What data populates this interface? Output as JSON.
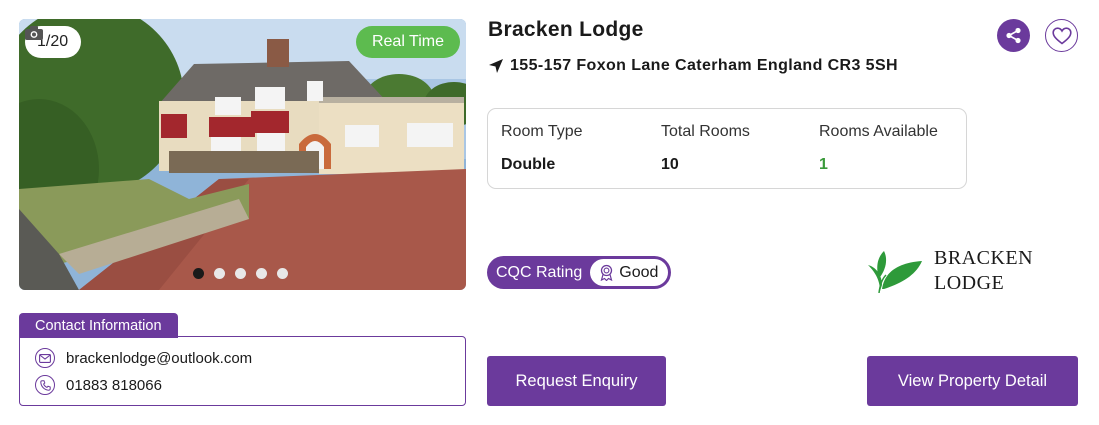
{
  "property": {
    "name": "Bracken Lodge",
    "address": "155-157 Foxon Lane Caterham England CR3 5SH"
  },
  "gallery": {
    "counter": "1/20",
    "badge": "Real Time",
    "dot_count": 5,
    "active_dot": 0
  },
  "rooms": {
    "headers": [
      "Room Type",
      "Total Rooms",
      "Rooms Available"
    ],
    "values": [
      "Double",
      "10",
      "1"
    ]
  },
  "cqc": {
    "label": "CQC Rating",
    "rating": "Good"
  },
  "logo": {
    "line1": "BRACKEN",
    "line2": "LODGE"
  },
  "contact": {
    "title": "Contact Information",
    "email": "brackenlodge@outlook.com",
    "phone": "01883 818066"
  },
  "actions": {
    "enquiry": "Request Enquiry",
    "detail": "View Property Detail"
  },
  "colors": {
    "brand": "#6b3a9c",
    "realtime": "#5dbb4f",
    "available": "#3a9a3a"
  }
}
